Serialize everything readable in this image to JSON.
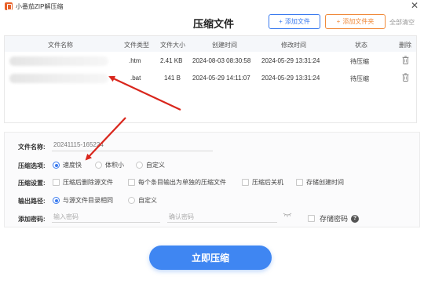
{
  "window": {
    "app_name": "小番茄ZIP解压缩",
    "close_glyph": "✕"
  },
  "header": {
    "title": "压缩文件",
    "add_file_label": "添加文件",
    "add_folder_label": "添加文件夹",
    "clear_all_label": "全部清空",
    "plus_glyph": "+"
  },
  "table": {
    "columns": [
      "文件名称",
      "文件类型",
      "文件大小",
      "创建时间",
      "修改时间",
      "状态",
      "删除"
    ],
    "rows": [
      {
        "type": ".htm",
        "size": "2.41 KB",
        "created": "2024-08-03 08:30:58",
        "modified": "2024-05-29 13:31:24",
        "status": "待压缩"
      },
      {
        "type": ".bat",
        "size": "141 B",
        "created": "2024-05-29 14:11:07",
        "modified": "2024-05-29 13:31:24",
        "status": "待压缩"
      }
    ]
  },
  "settings": {
    "file_name_label": "文件名称:",
    "file_name_value": "20241115-165224",
    "compress_option_label": "压缩选项:",
    "compress_options": [
      "速度快",
      "体积小",
      "自定义"
    ],
    "compress_selected": "速度快",
    "compress_settings_label": "压缩设置:",
    "compress_settings": [
      "压缩后删除源文件",
      "每个条目输出为单独的压缩文件",
      "压缩后关机",
      "存储创建时间"
    ],
    "output_path_label": "输出路径:",
    "output_options": [
      "与源文件目录相同",
      "自定义"
    ],
    "output_selected": "与源文件目录相同",
    "password_label": "添加密码:",
    "password_placeholder": "输入密码",
    "confirm_placeholder": "确认密码",
    "save_password_label": "存储密码",
    "help_glyph": "?"
  },
  "actions": {
    "start_label": "立即压缩"
  },
  "colors": {
    "accent_blue": "#3a7bef",
    "accent_orange": "#f08a3a",
    "annotation_red": "#d9261c"
  }
}
